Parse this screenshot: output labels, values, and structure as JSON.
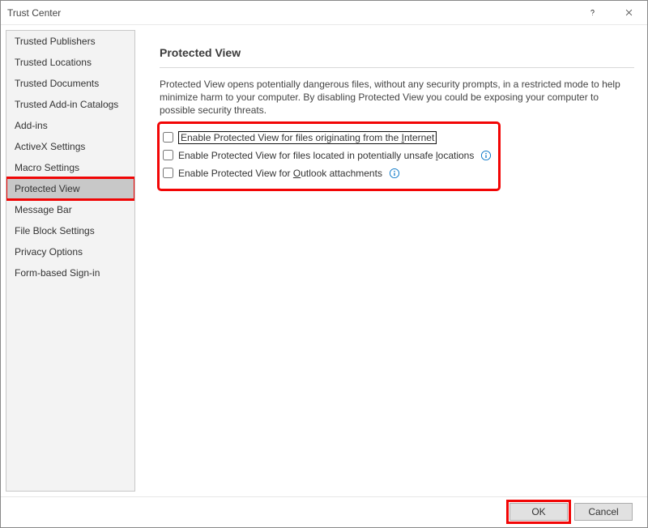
{
  "titlebar": {
    "title": "Trust Center"
  },
  "sidebar": {
    "items": [
      {
        "label": "Trusted Publishers"
      },
      {
        "label": "Trusted Locations"
      },
      {
        "label": "Trusted Documents"
      },
      {
        "label": "Trusted Add-in Catalogs"
      },
      {
        "label": "Add-ins"
      },
      {
        "label": "ActiveX Settings"
      },
      {
        "label": "Macro Settings"
      },
      {
        "label": "Protected View"
      },
      {
        "label": "Message Bar"
      },
      {
        "label": "File Block Settings"
      },
      {
        "label": "Privacy Options"
      },
      {
        "label": "Form-based Sign-in"
      }
    ],
    "selectedIndex": 7
  },
  "section": {
    "title": "Protected View",
    "description": "Protected View opens potentially dangerous files, without any security prompts, in a restricted mode to help minimize harm to your computer. By disabling Protected View you could be exposing your computer to possible security threats."
  },
  "checkboxes": {
    "opt1_pre": "Enable Protected View for files originating from the ",
    "opt1_mn": "I",
    "opt1_post": "nternet",
    "opt2_pre": "Enable Protected View for files located in potentially unsafe ",
    "opt2_mn": "l",
    "opt2_post": "ocations",
    "opt3_pre": "Enable Protected View for ",
    "opt3_mn": "O",
    "opt3_post": "utlook attachments"
  },
  "footer": {
    "ok": "OK",
    "cancel": "Cancel"
  }
}
